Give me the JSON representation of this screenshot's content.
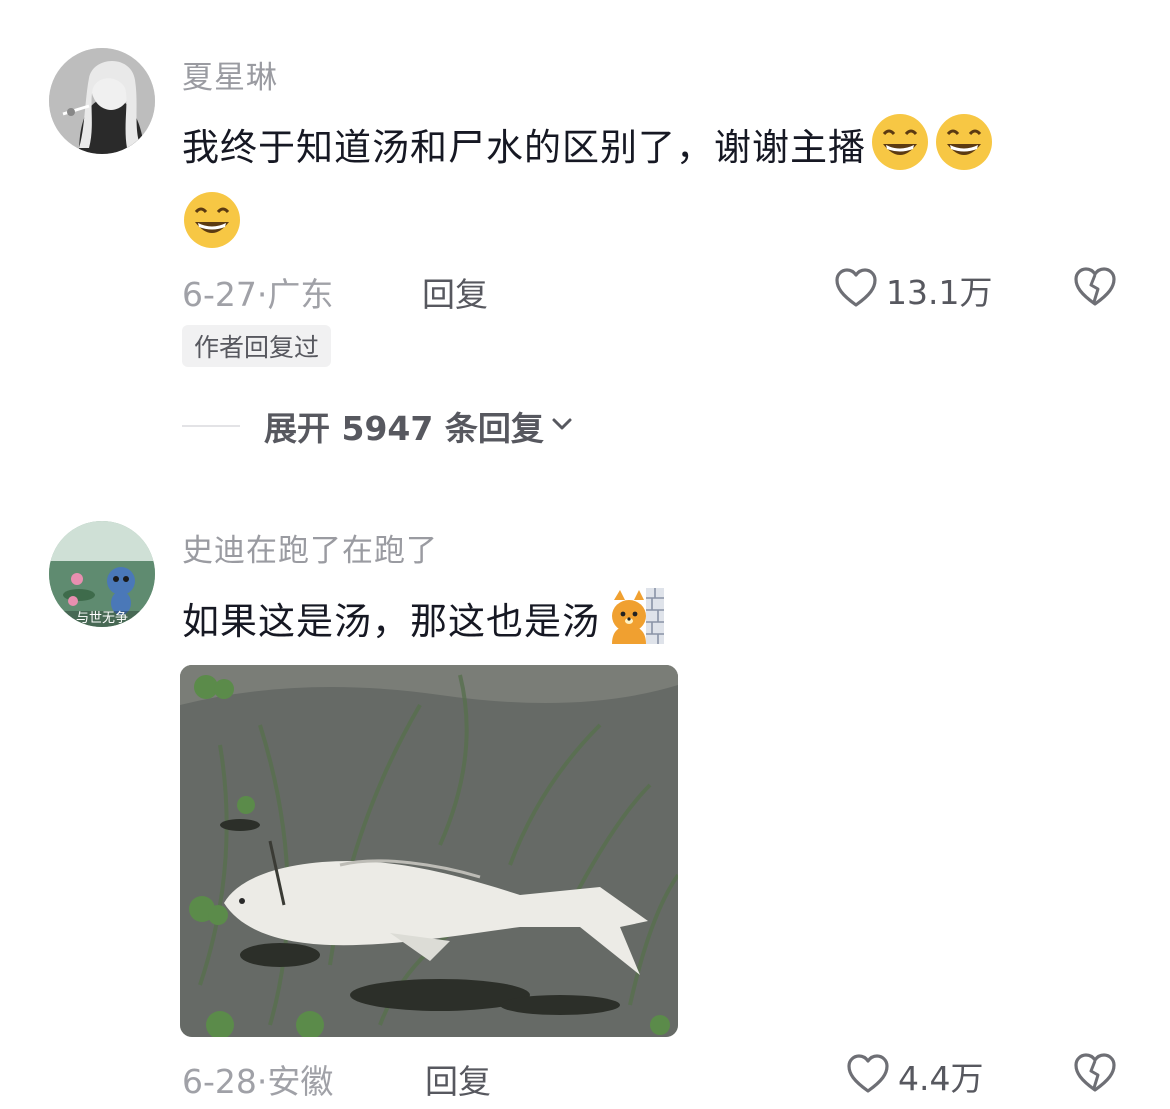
{
  "comments": [
    {
      "username": "夏星琳",
      "text": "我终于知道汤和尸水的区别了，谢谢主播",
      "emoji": "grinning-face-icon",
      "date": "6-27",
      "dot": "·",
      "location": "广东",
      "reply_label": "回复",
      "likes": "13.1万",
      "author_badge": "作者回复过",
      "expand_label": "展开 5947 条回复"
    },
    {
      "username": "史迪在跑了在跑了",
      "avatar_text": "与世无争",
      "text": "如果这是汤，那这也是汤",
      "emoji": "cat-peeking-wall-icon",
      "date": "6-28",
      "dot": "·",
      "location": "安徽",
      "reply_label": "回复",
      "likes": "4.4万"
    }
  ],
  "colors": {
    "primary_text": "#161823",
    "secondary_text": "#9a9ba1",
    "action_text": "#57585f",
    "badge_bg": "#f1f1f2"
  }
}
